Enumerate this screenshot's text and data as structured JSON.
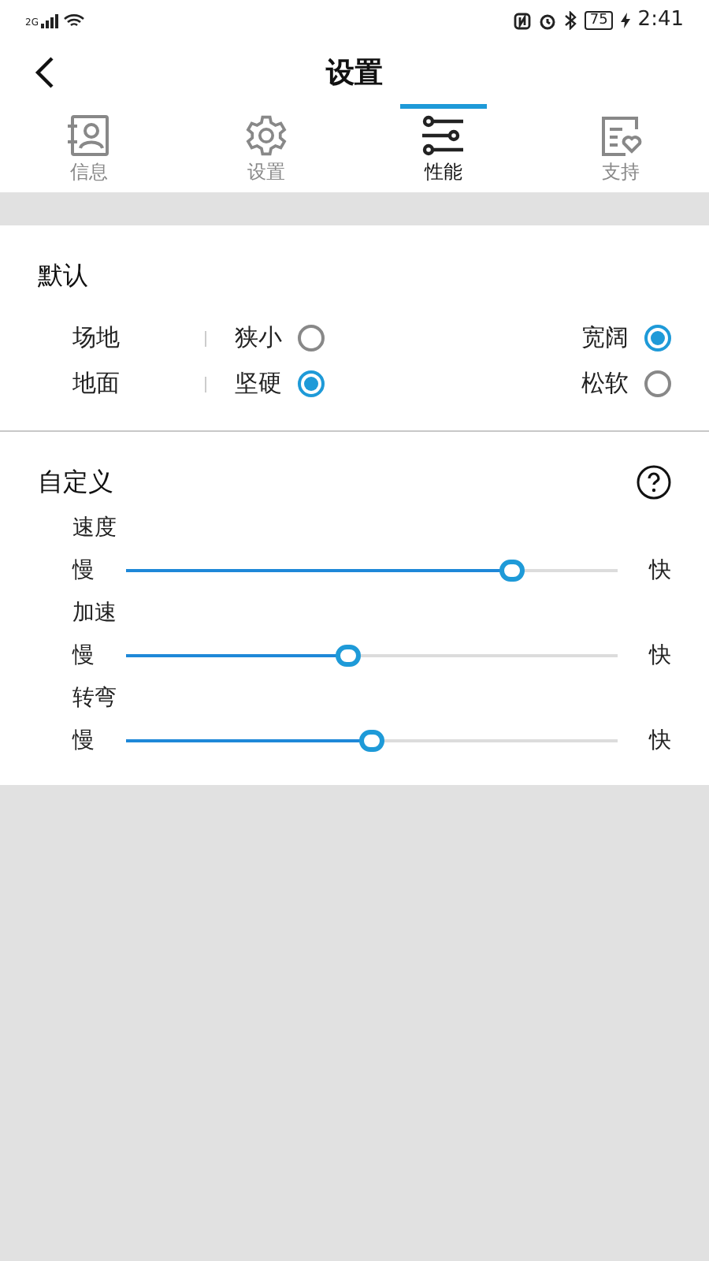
{
  "status_bar": {
    "network": "2G",
    "battery": "75",
    "time": "2:41"
  },
  "header": {
    "title": "设置"
  },
  "tabs": [
    {
      "label": "信息",
      "selected": false
    },
    {
      "label": "设置",
      "selected": false
    },
    {
      "label": "性能",
      "selected": true
    },
    {
      "label": "支持",
      "selected": false
    }
  ],
  "default_section": {
    "title": "默认",
    "rows": [
      {
        "label": "场地",
        "options": [
          {
            "label": "狭小",
            "selected": false
          },
          {
            "label": "宽阔",
            "selected": true
          }
        ]
      },
      {
        "label": "地面",
        "options": [
          {
            "label": "坚硬",
            "selected": true
          },
          {
            "label": "松软",
            "selected": false
          }
        ]
      }
    ]
  },
  "custom_section": {
    "title": "自定义",
    "sliders": [
      {
        "label": "速度",
        "min_label": "慢",
        "max_label": "快",
        "level": 0.8
      },
      {
        "label": "加速",
        "min_label": "慢",
        "max_label": "快",
        "level": 0.45
      },
      {
        "label": "转弯",
        "min_label": "慢",
        "max_label": "快",
        "level": 0.5
      }
    ]
  }
}
